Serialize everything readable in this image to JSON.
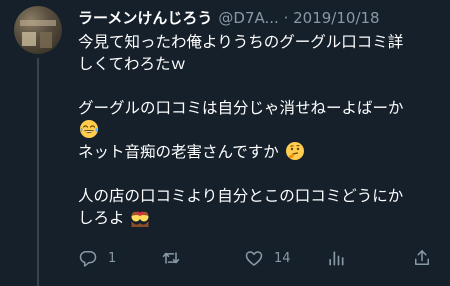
{
  "tweet": {
    "author": {
      "display_name": "ラーメンけんじろう",
      "handle": "@D7A...",
      "separator": " · ",
      "date": "2019/10/18"
    },
    "paragraphs": [
      {
        "lines": [
          {
            "text": "今見て知ったわ俺よりうちのグーグル口コミ詳",
            "emoji": null
          },
          {
            "text": "しくてわろたｗ",
            "emoji": null
          }
        ]
      },
      {
        "lines": [
          {
            "text": "グーグルの口コミは自分じゃ消せねーよばーか",
            "emoji": null
          },
          {
            "text": "",
            "emoji": "tears-of-joy"
          },
          {
            "text": "ネット音痴の老害さんですか",
            "emoji": "thinking"
          }
        ]
      },
      {
        "lines": [
          {
            "text": "人の店の口コミより自分とこの口コミどうにか",
            "emoji": null
          },
          {
            "text": "しろよ",
            "emoji": "couple-with-heart"
          }
        ]
      }
    ],
    "actions": {
      "reply": {
        "icon": "reply-icon",
        "count": "1"
      },
      "retweet": {
        "icon": "retweet-icon",
        "count": ""
      },
      "like": {
        "icon": "heart-icon",
        "count": "14"
      },
      "analytics": {
        "icon": "analytics-icon",
        "count": ""
      },
      "share": {
        "icon": "share-icon",
        "count": ""
      }
    },
    "colors": {
      "background": "#15202b",
      "text": "#ffffff",
      "muted": "#8899a6",
      "thread_line": "#38444d"
    }
  }
}
